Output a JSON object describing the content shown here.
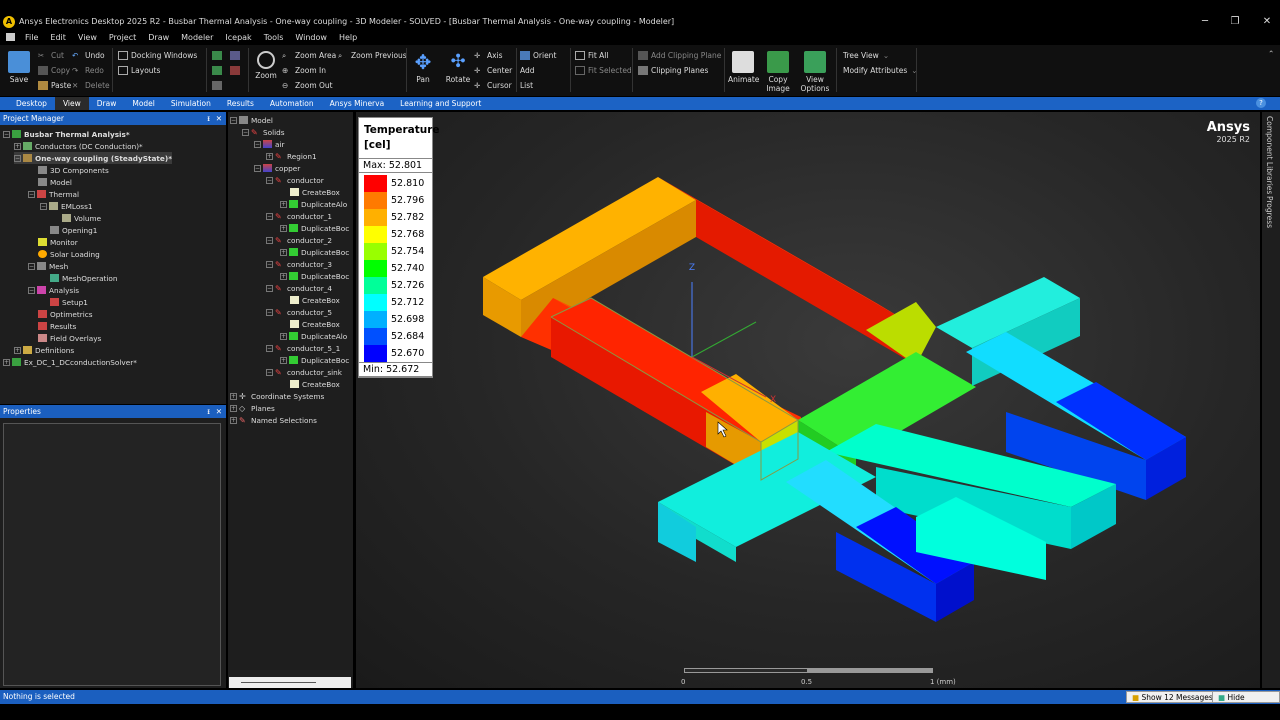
{
  "window": {
    "title": "Ansys Electronics Desktop 2025 R2 - Busbar Thermal Analysis - One-way coupling - 3D Modeler - SOLVED - [Busbar Thermal Analysis - One-way coupling - Modeler]",
    "minimize": "─",
    "maximize": "❐",
    "close": "✕"
  },
  "menu": [
    "File",
    "Edit",
    "View",
    "Project",
    "Draw",
    "Modeler",
    "Icepak",
    "Tools",
    "Window",
    "Help"
  ],
  "ribbon": {
    "save": "Save",
    "cut": "Cut",
    "copy": "Copy",
    "paste": "Paste",
    "undo": "Undo",
    "redo": "Redo",
    "delete": "Delete",
    "docking_windows": "Docking Windows",
    "layouts": "Layouts",
    "zoom": "Zoom",
    "zoom_area": "Zoom Area",
    "zoom_previous": "Zoom Previous",
    "zoom_in": "Zoom In",
    "zoom_out": "Zoom Out",
    "pan": "Pan",
    "rotate": "Rotate",
    "axis": "Axis",
    "center": "Center",
    "cursor": "Cursor",
    "orient": "Orient",
    "add": "Add",
    "list": "List",
    "fit_all": "Fit All",
    "fit_selected": "Fit Selected",
    "add_clipping_plane": "Add Clipping Plane",
    "clipping_planes": "Clipping Planes",
    "animate": "Animate",
    "copy_image": "Copy Image",
    "view_options": "View Options",
    "tree_view": "Tree View",
    "modify_attributes": "Modify Attributes"
  },
  "tabs": [
    "Desktop",
    "View",
    "Draw",
    "Model",
    "Simulation",
    "Results",
    "Automation",
    "Ansys Minerva",
    "Learning and Support"
  ],
  "project_manager": {
    "title": "Project Manager",
    "pin": "ᵻ",
    "close": "✕",
    "items": [
      {
        "label": "Busbar Thermal Analysis*"
      },
      {
        "label": "Conductors (DC Conduction)*"
      },
      {
        "label": "One-way coupling (SteadyState)*"
      },
      {
        "label": "3D Components"
      },
      {
        "label": "Model"
      },
      {
        "label": "Thermal"
      },
      {
        "label": "EMLoss1"
      },
      {
        "label": "Volume"
      },
      {
        "label": "Opening1"
      },
      {
        "label": "Monitor"
      },
      {
        "label": "Solar Loading"
      },
      {
        "label": "Mesh"
      },
      {
        "label": "MeshOperation"
      },
      {
        "label": "Analysis"
      },
      {
        "label": "Setup1"
      },
      {
        "label": "Optimetrics"
      },
      {
        "label": "Results"
      },
      {
        "label": "Field Overlays"
      },
      {
        "label": "Definitions"
      },
      {
        "label": "Ex_DC_1_DCconductionSolver*"
      }
    ]
  },
  "properties": {
    "title": "Properties",
    "pin": "ᵻ",
    "close": "✕"
  },
  "model_tree": {
    "items": [
      {
        "label": "Model"
      },
      {
        "label": "Solids"
      },
      {
        "label": "air"
      },
      {
        "label": "Region1"
      },
      {
        "label": "copper"
      },
      {
        "label": "conductor"
      },
      {
        "label": "CreateBox"
      },
      {
        "label": "DuplicateAlo"
      },
      {
        "label": "conductor_1"
      },
      {
        "label": "DuplicateBoc"
      },
      {
        "label": "conductor_2"
      },
      {
        "label": "DuplicateBoc"
      },
      {
        "label": "conductor_3"
      },
      {
        "label": "DuplicateBoc"
      },
      {
        "label": "conductor_4"
      },
      {
        "label": "CreateBox"
      },
      {
        "label": "conductor_5"
      },
      {
        "label": "CreateBox"
      },
      {
        "label": "DuplicateAlo"
      },
      {
        "label": "conductor_5_1"
      },
      {
        "label": "DuplicateBoc"
      },
      {
        "label": "conductor_sink"
      },
      {
        "label": "CreateBox"
      },
      {
        "label": "Coordinate Systems"
      },
      {
        "label": "Planes"
      },
      {
        "label": "Named Selections"
      }
    ]
  },
  "legend": {
    "title_line1": "Temperature",
    "title_line2": "[cel]",
    "max": "Max: 52.801",
    "min": "Min: 52.672",
    "entries": [
      {
        "value": "52.810",
        "color": "#ff0000"
      },
      {
        "value": "52.796",
        "color": "#ff7a00"
      },
      {
        "value": "52.782",
        "color": "#ffb000"
      },
      {
        "value": "52.768",
        "color": "#ffff00"
      },
      {
        "value": "52.754",
        "color": "#99ff00"
      },
      {
        "value": "52.740",
        "color": "#00ff00"
      },
      {
        "value": "52.726",
        "color": "#00ff99"
      },
      {
        "value": "52.712",
        "color": "#00ffff"
      },
      {
        "value": "52.698",
        "color": "#00b0ff"
      },
      {
        "value": "52.684",
        "color": "#0050ff"
      },
      {
        "value": "52.670",
        "color": "#0000ff"
      }
    ]
  },
  "brand": {
    "name": "Ansys",
    "version": "2025 R2"
  },
  "right_sidebar": {
    "tab1": "Component Libraries",
    "tab2": "Progress"
  },
  "scale": {
    "t0": "0",
    "t1": "0.5",
    "t2": "1 (mm)"
  },
  "axis_labels": {
    "z": "Z",
    "x": "X"
  },
  "status": {
    "text": "Nothing is selected",
    "messages_button": "Show 12 Messages",
    "progress_button": "Hide Progress"
  }
}
